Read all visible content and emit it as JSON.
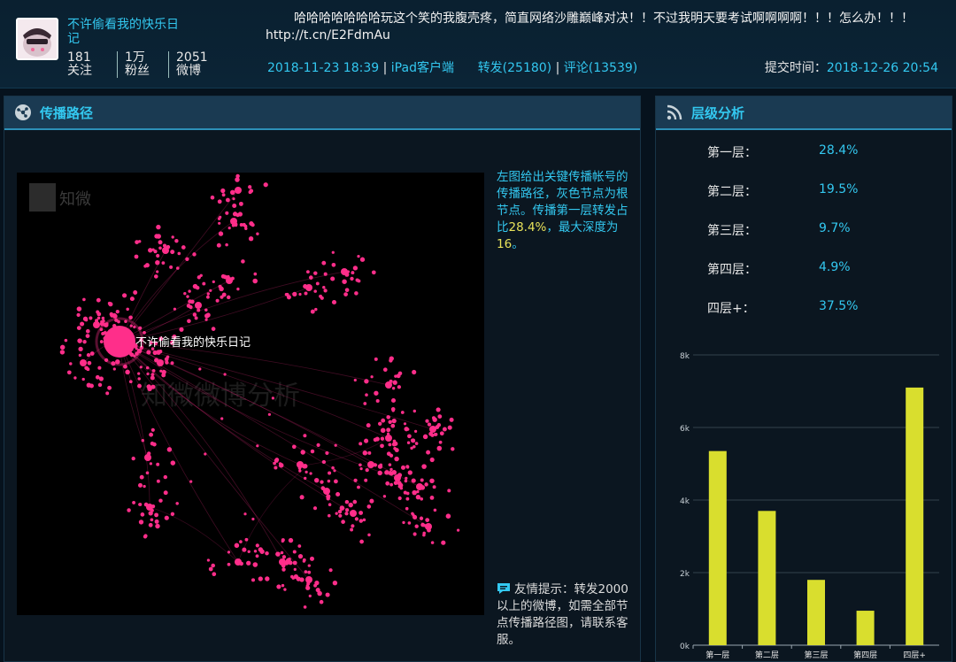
{
  "user": {
    "name": "不许偷看我的快乐日记",
    "stats": [
      {
        "value": "181",
        "label": "关注"
      },
      {
        "value": "1万",
        "label": "粉丝"
      },
      {
        "value": "2051",
        "label": "微博"
      }
    ]
  },
  "post": {
    "text": "哈哈哈哈哈哈哈玩这个笑的我腹壳疼，简直网络沙雕巅峰对决！！不过我明天要考试啊啊啊啊！！！怎么办！！！http://t.cn/E2FdmAu",
    "datetime": "2018-11-23 18:39",
    "client": "iPad客户端",
    "repost": "转发(25180)",
    "comment": "评论(13539)",
    "submit_label": "提交时间：",
    "submit_time": "2018-12-26 20:54"
  },
  "left_panel": {
    "title": "传播路径",
    "graph_root_label": "不许偷看我的快乐日记",
    "logo_text": "知微",
    "watermark": "知微微博分析",
    "note_part1": "左图给出关键传播帐号的传播路径，灰色节点为根节点。传播第一层转发占比",
    "note_highlight1": "28.4%",
    "note_part2": "，最大深度为",
    "note_highlight2": "16",
    "note_part3": "。",
    "tip": "友情提示：转发2000以上的微博，如需全部节点传播路径图，请联系客服。"
  },
  "right_panel": {
    "title": "层级分析",
    "levels": [
      {
        "label": "第一层：",
        "value": "28.4%"
      },
      {
        "label": "第二层：",
        "value": "19.5%"
      },
      {
        "label": "第三层：",
        "value": "9.7%"
      },
      {
        "label": "第四层：",
        "value": "4.9%"
      },
      {
        "label": "四层+：",
        "value": "37.5%"
      }
    ]
  },
  "colors": {
    "accent": "#33c8f0",
    "highlight": "#e8e25a",
    "bar": "#d9de2e",
    "node": "#ff2e8a"
  },
  "chart_data": {
    "type": "bar",
    "categories": [
      "第一层",
      "第二层",
      "第三层",
      "第四层",
      "四层+"
    ],
    "values": [
      5350,
      3700,
      1800,
      950,
      7100
    ],
    "yticks": [
      "0k",
      "2k",
      "4k",
      "6k",
      "8k"
    ],
    "ylim": [
      0,
      8000
    ]
  }
}
